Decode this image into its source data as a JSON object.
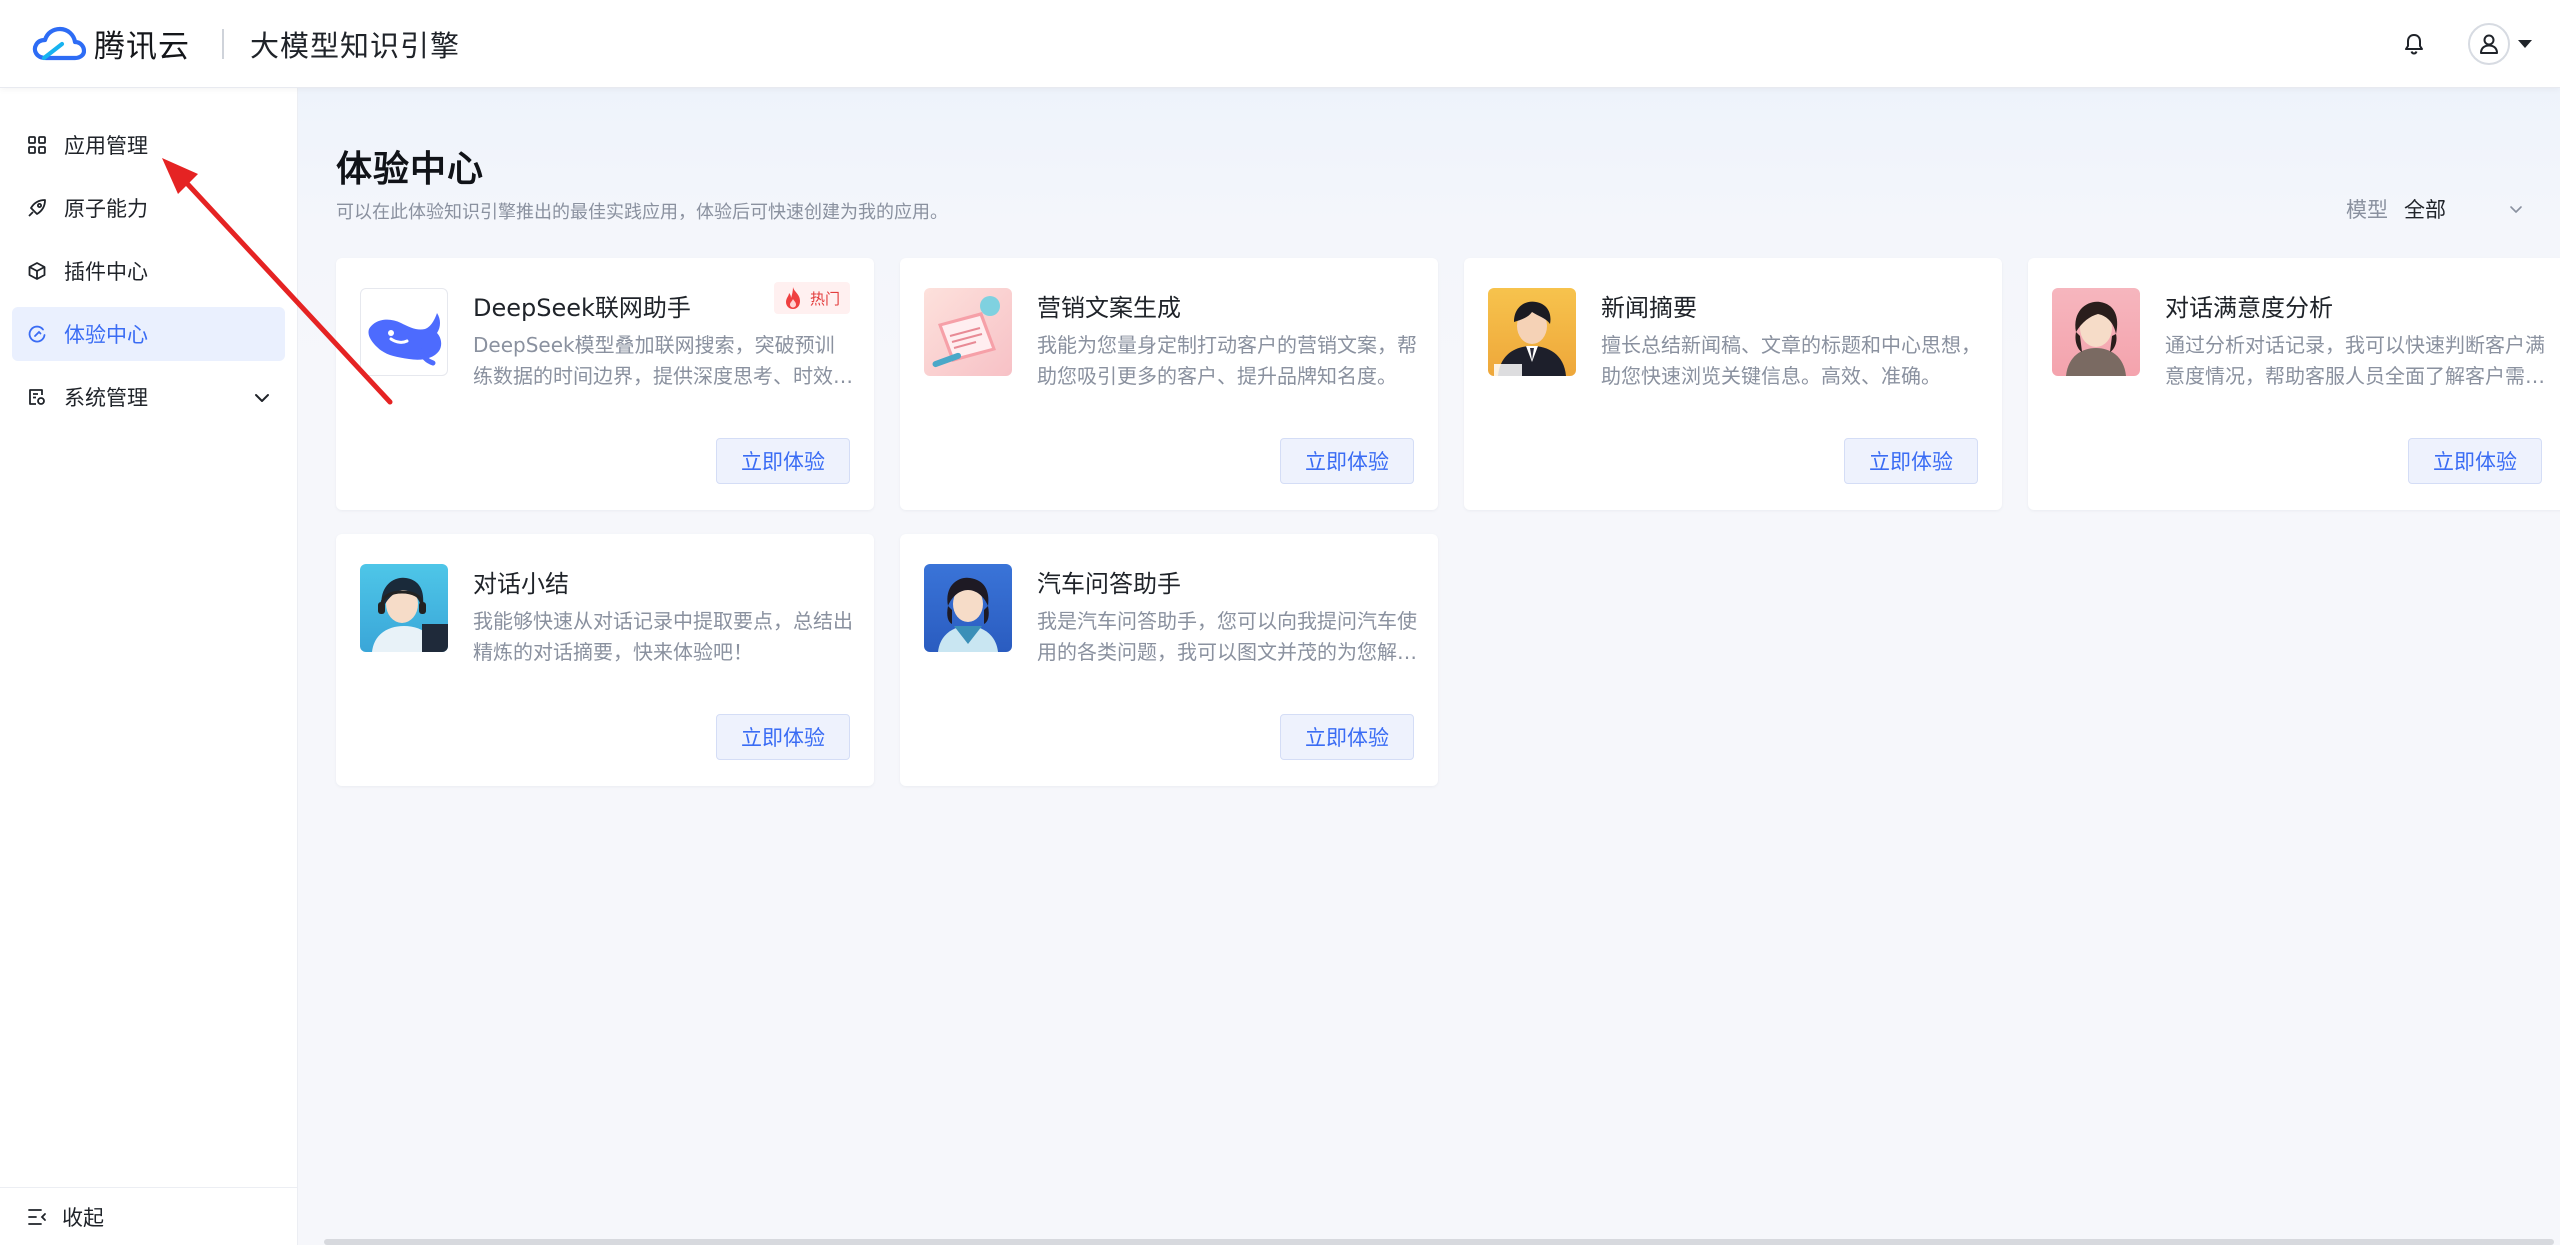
{
  "header": {
    "brand_name": "腾讯云",
    "product_name": "大模型知识引擎"
  },
  "sidebar": {
    "items": [
      {
        "label": "应用管理"
      },
      {
        "label": "原子能力"
      },
      {
        "label": "插件中心"
      },
      {
        "label": "体验中心"
      },
      {
        "label": "系统管理"
      }
    ],
    "collapse_label": "收起"
  },
  "main": {
    "title": "体验中心",
    "subtitle": "可以在此体验知识引擎推出的最佳实践应用，体验后可快速创建为我的应用。",
    "filter": {
      "label": "模型",
      "value": "全部"
    },
    "cards": [
      {
        "title": "DeepSeek联网助手",
        "desc": "DeepSeek模型叠加联网搜索，突破预训练数据的时间边界，提供深度思考、时效性信息检索能力。",
        "button": "立即体验",
        "badge": "热门"
      },
      {
        "title": "营销文案生成",
        "desc": "我能为您量身定制打动客户的营销文案，帮助您吸引更多的客户、提升品牌知名度。",
        "button": "立即体验"
      },
      {
        "title": "新闻摘要",
        "desc": "擅长总结新闻稿、文章的标题和中心思想，助您快速浏览关键信息。高效、准确。",
        "button": "立即体验"
      },
      {
        "title": "对话满意度分析",
        "desc": "通过分析对话记录，我可以快速判断客户满意度情况，帮助客服人员全面了解客户需求。",
        "button": "立即体验"
      },
      {
        "title": "对话小结",
        "desc": "我能够快速从对话记录中提取要点，总结出精炼的对话摘要，快来体验吧！",
        "button": "立即体验"
      },
      {
        "title": "汽车问答助手",
        "desc": "我是汽车问答助手，您可以向我提问汽车使用的各类问题，我可以图文并茂的为您解答。",
        "button": "立即体验"
      }
    ]
  },
  "colors": {
    "accent": "#3a6cf4",
    "annotation_arrow": "#e52323",
    "hot": "#e33d3d"
  }
}
